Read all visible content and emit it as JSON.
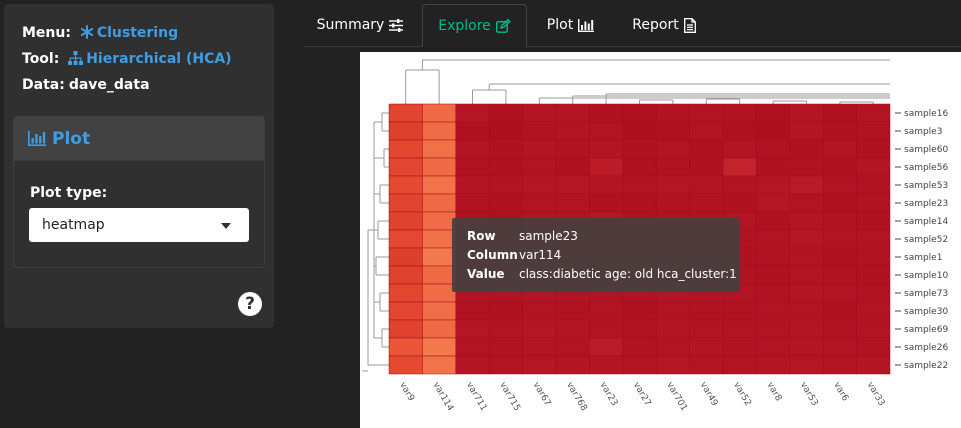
{
  "sidebar": {
    "menu_label": "Menu:",
    "menu_value": "Clustering",
    "tool_label": "Tool:",
    "tool_value": "Hierarchical (HCA)",
    "data_label": "Data:",
    "data_value": "dave_data",
    "accent_color": "#3c9ee5"
  },
  "panel": {
    "title": "Plot",
    "plot_type_label": "Plot type:",
    "plot_type_value": "heatmap",
    "help_text": "?"
  },
  "tabs": [
    {
      "label": "Summary",
      "icon": "sliders-icon",
      "active": false
    },
    {
      "label": "Explore",
      "icon": "edit-icon",
      "active": true
    },
    {
      "label": "Plot",
      "icon": "bar-chart-icon",
      "active": false
    },
    {
      "label": "Report",
      "icon": "document-icon",
      "active": false
    }
  ],
  "heatmap": {
    "rows": [
      "sample16",
      "sample3",
      "sample60",
      "sample56",
      "sample53",
      "sample23",
      "sample14",
      "sample52",
      "sample1",
      "sample10",
      "sample73",
      "sample30",
      "sample69",
      "sample26",
      "sample22"
    ],
    "columns": [
      "var9",
      "var114",
      "var711",
      "var715",
      "var67",
      "var768",
      "var23",
      "var27",
      "var701",
      "var49",
      "var52",
      "var8",
      "var53",
      "var6",
      "var33"
    ],
    "cell_colors": [
      [
        "#e2442f",
        "#ef6a45",
        "#b41626",
        "#b01222",
        "#b31525",
        "#b31525",
        "#b01222",
        "#b01222",
        "#b11323",
        "#b21424",
        "#b11323",
        "#af1121",
        "#b31525",
        "#b01222",
        "#b21424"
      ],
      [
        "#df402d",
        "#f06c46",
        "#b01222",
        "#ae1020",
        "#b11323",
        "#b21424",
        "#b21424",
        "#ae1020",
        "#af1121",
        "#b21424",
        "#af1121",
        "#ae1020",
        "#b31525",
        "#b01222",
        "#b11323"
      ],
      [
        "#e3472f",
        "#f07048",
        "#b21424",
        "#b01222",
        "#b31525",
        "#b11323",
        "#b31525",
        "#b01222",
        "#b21424",
        "#af1121",
        "#b31525",
        "#b11323",
        "#b01222",
        "#b21424",
        "#b01222"
      ],
      [
        "#e24530",
        "#ef6b45",
        "#b11323",
        "#af1121",
        "#b21424",
        "#b01222",
        "#bb1c28",
        "#af1121",
        "#b11323",
        "#b01222",
        "#c4232d",
        "#b01222",
        "#b11323",
        "#af1121",
        "#b31525"
      ],
      [
        "#e54a31",
        "#f27349",
        "#b31525",
        "#b21424",
        "#b41626",
        "#b51727",
        "#b31525",
        "#b21424",
        "#b41626",
        "#b31525",
        "#b21424",
        "#b41626",
        "#b81a27",
        "#b21424",
        "#b11323"
      ],
      [
        "#e2442f",
        "#ee6a45",
        "#b11323",
        "#af1121",
        "#b21424",
        "#b21424",
        "#b01222",
        "#af1121",
        "#b11323",
        "#b11323",
        "#b01222",
        "#b41626",
        "#b21424",
        "#af1121",
        "#b11323"
      ],
      [
        "#e0422e",
        "#ef6c46",
        "#b01222",
        "#af1121",
        "#b21424",
        "#b11323",
        "#b41626",
        "#b01222",
        "#b11323",
        "#b11323",
        "#b21424",
        "#b01222",
        "#b31525",
        "#b11323",
        "#b01222"
      ],
      [
        "#e44830",
        "#f07048",
        "#b21424",
        "#b11323",
        "#b31525",
        "#b21424",
        "#b21424",
        "#b11323",
        "#b31525",
        "#b41626",
        "#b11323",
        "#b21424",
        "#b41626",
        "#b21424",
        "#b21424"
      ],
      [
        "#de3f2c",
        "#f37a4c",
        "#b11323",
        "#b01222",
        "#b11323",
        "#b21424",
        "#b11323",
        "#b01222",
        "#b21424",
        "#b11323",
        "#b01222",
        "#b11323",
        "#b21424",
        "#b01222",
        "#b11323"
      ],
      [
        "#e0422e",
        "#ef6b45",
        "#b11323",
        "#b01222",
        "#b21424",
        "#b11323",
        "#b21424",
        "#b01222",
        "#b11323",
        "#b21424",
        "#b11323",
        "#b01222",
        "#b21424",
        "#b11323",
        "#b01222"
      ],
      [
        "#e3462f",
        "#ef6c46",
        "#b21424",
        "#b11323",
        "#b31525",
        "#b21424",
        "#b11323",
        "#b11323",
        "#b31525",
        "#b21424",
        "#b21424",
        "#b11323",
        "#b31525",
        "#b21424",
        "#b11323"
      ],
      [
        "#e24530",
        "#f06e47",
        "#b11323",
        "#b01222",
        "#b21424",
        "#b11323",
        "#b21424",
        "#b01222",
        "#b21424",
        "#b11323",
        "#b11323",
        "#b21424",
        "#b21424",
        "#b01222",
        "#b21424"
      ],
      [
        "#e0422e",
        "#ef6a45",
        "#b41626",
        "#b21424",
        "#b41626",
        "#b31525",
        "#b21424",
        "#b11323",
        "#b31525",
        "#b21424",
        "#b21424",
        "#b21424",
        "#b31525",
        "#b11323",
        "#b21424"
      ],
      [
        "#ea5637",
        "#f37a4c",
        "#b21424",
        "#b11323",
        "#b31525",
        "#b21424",
        "#bb1c28",
        "#b11323",
        "#b21424",
        "#b31525",
        "#b11323",
        "#b21424",
        "#b31525",
        "#b21424",
        "#b11323"
      ],
      [
        "#e54a31",
        "#f27349",
        "#b31525",
        "#b21424",
        "#b41626",
        "#b31525",
        "#b31525",
        "#b21424",
        "#b41626",
        "#b31525",
        "#b21424",
        "#b31525",
        "#b41626",
        "#b21424",
        "#b31525"
      ]
    ],
    "tooltip": {
      "row_key": "Row",
      "row_val": "sample23",
      "col_key": "Column",
      "col_val": "var114",
      "value_key": "Value",
      "value_val": "class:diabetic age: old hca_cluster:1"
    }
  }
}
